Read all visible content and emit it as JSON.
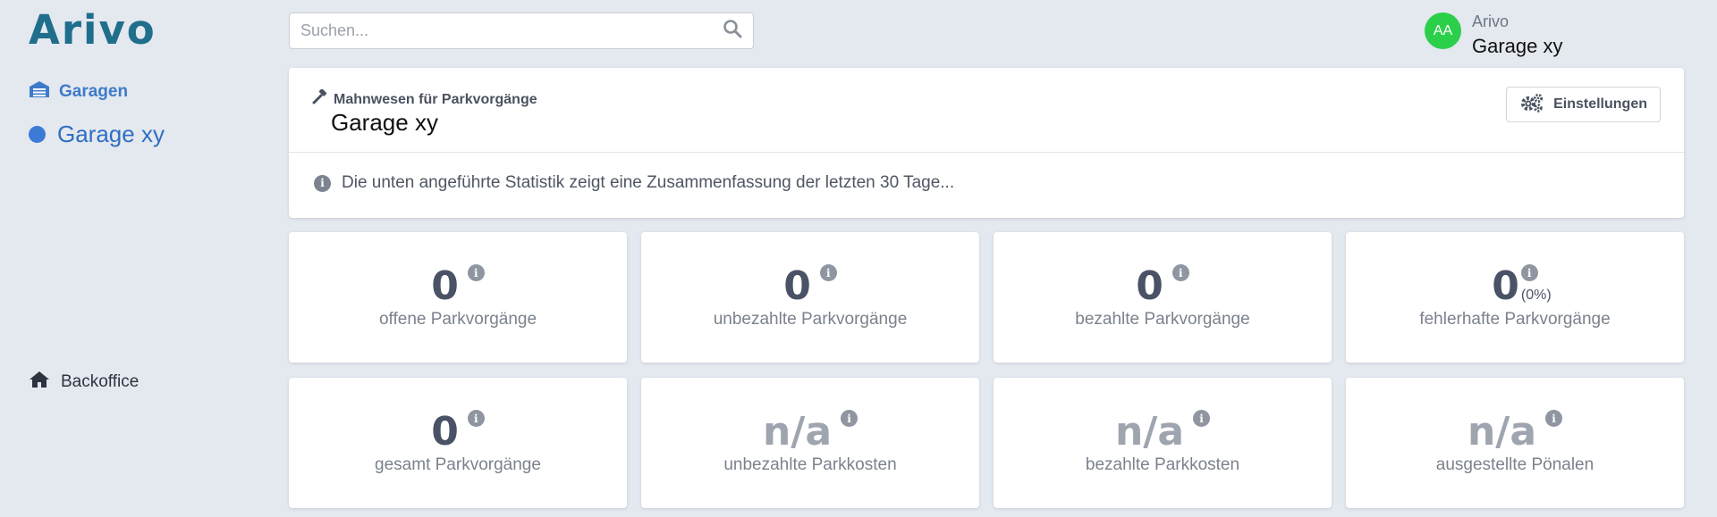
{
  "app": {
    "logo": "Arivo"
  },
  "sidebar": {
    "section_label": "Garagen",
    "garage_item": "Garage xy",
    "backoffice_label": "Backoffice"
  },
  "search": {
    "placeholder": "Suchen..."
  },
  "user": {
    "initials": "AA",
    "name": "Arivo",
    "garage": "Garage xy"
  },
  "header": {
    "kicker": "Mahnwesen für Parkvorgänge",
    "title": "Garage xy",
    "settings_label": "Einstellungen",
    "info_text": "Die unten angeführte Statistik zeigt eine Zusammenfassung der letzten 30 Tage..."
  },
  "stats": [
    {
      "value": "0",
      "pct": "",
      "label": "offene Parkvorgänge"
    },
    {
      "value": "0",
      "pct": "",
      "label": "unbezahlte Parkvorgänge"
    },
    {
      "value": "0",
      "pct": "",
      "label": "bezahlte Parkvorgänge"
    },
    {
      "value": "0",
      "pct": "(0%)",
      "label": "fehlerhafte Parkvorgänge"
    },
    {
      "value": "0",
      "pct": "",
      "label": "gesamt Parkvorgänge"
    },
    {
      "value": "n/a",
      "pct": "",
      "label": "unbezahlte Parkkosten"
    },
    {
      "value": "n/a",
      "pct": "",
      "label": "bezahlte Parkkosten"
    },
    {
      "value": "n/a",
      "pct": "",
      "label": "ausgestellte Pönalen"
    }
  ],
  "icons": {
    "garage": "garage-icon",
    "home": "home-icon",
    "search": "search-icon",
    "settings": "gears-icon",
    "info": "info-icon",
    "hammer": "hammer-icon"
  },
  "colors": {
    "accent": "#3b7bd6",
    "logo": "#1f6e8c",
    "avatar": "#2ccf4a"
  }
}
